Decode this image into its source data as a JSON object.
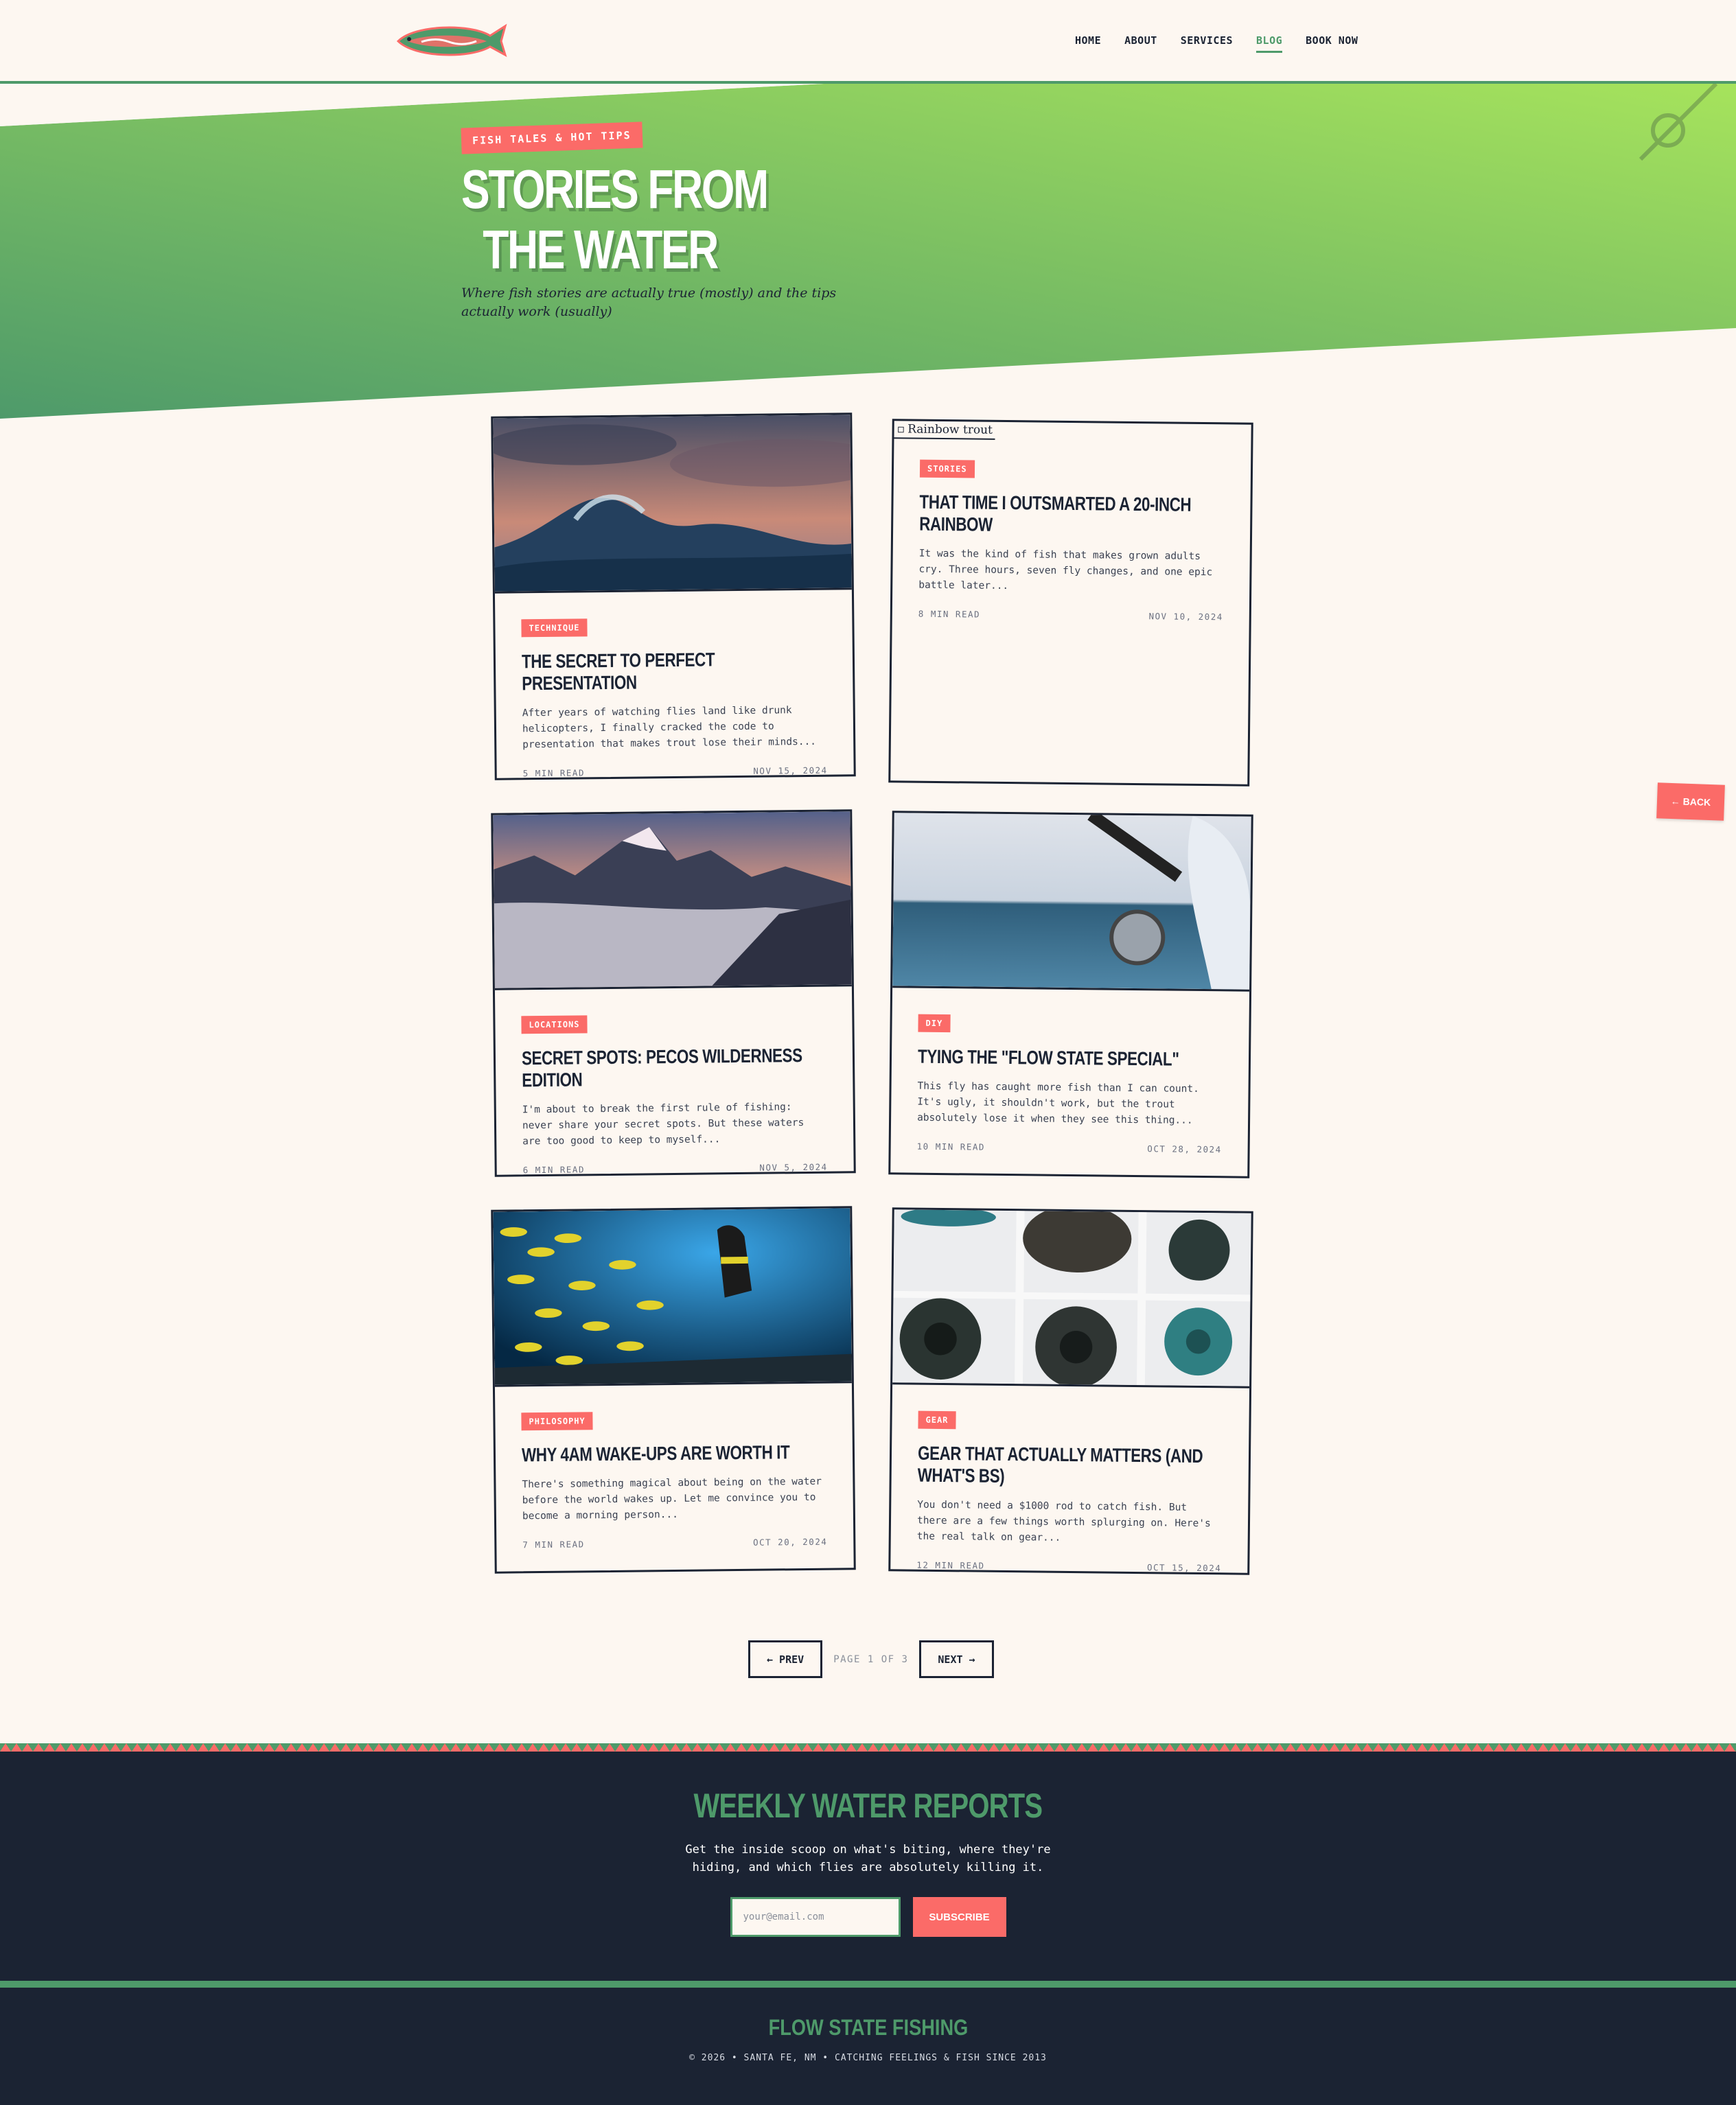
{
  "nav": {
    "links": [
      {
        "label": "HOME"
      },
      {
        "label": "ABOUT"
      },
      {
        "label": "SERVICES"
      },
      {
        "label": "BLOG",
        "active": true
      },
      {
        "label": "BOOK NOW"
      }
    ]
  },
  "hero": {
    "badge": "FISH TALES & HOT TIPS",
    "title_line1": "STORIES FROM",
    "title_line2": "THE WATER",
    "subtitle": "Where fish stories are actually true (mostly) and the tips actually work (usually)"
  },
  "posts": [
    {
      "tag": "TECHNIQUE",
      "title": "The Secret to Perfect Presentation",
      "excerpt": "After years of watching flies land like drunk helicopters, I finally cracked the code to presentation that makes trout lose their minds...",
      "read": "5 MIN READ",
      "date": "NOV 15, 2024",
      "image": "wave"
    },
    {
      "tag": "STORIES",
      "title": "That Time I Outsmarted a 20-Inch Rainbow",
      "excerpt": "It was the kind of fish that makes grown adults cry. Three hours, seven fly changes, and one epic battle later...",
      "read": "8 MIN READ",
      "date": "NOV 10, 2024",
      "image_alt": "Rainbow trout"
    },
    {
      "tag": "LOCATIONS",
      "title": "Secret Spots: Pecos Wilderness Edition",
      "excerpt": "I'm about to break the first rule of fishing: never share your secret spots. But these waters are too good to keep to myself...",
      "read": "6 MIN READ",
      "date": "NOV 5, 2024",
      "image": "mountains"
    },
    {
      "tag": "DIY",
      "title": "Tying the \"Flow State Special\"",
      "excerpt": "This fly has caught more fish than I can count. It's ugly, it shouldn't work, but the trout absolutely lose it when they see this thing...",
      "read": "10 MIN READ",
      "date": "OCT 28, 2024",
      "image": "reel"
    },
    {
      "tag": "PHILOSOPHY",
      "title": "Why 4AM Wake-Ups Are Worth It",
      "excerpt": "There's something magical about being on the water before the world wakes up. Let me convince you to become a morning person...",
      "read": "7 MIN READ",
      "date": "OCT 20, 2024",
      "image": "diver"
    },
    {
      "tag": "GEAR",
      "title": "Gear That Actually Matters (And What's BS)",
      "excerpt": "You don't need a $1000 rod to catch fish. But there are a few things worth splurging on. Here's the real talk on gear...",
      "read": "12 MIN READ",
      "date": "OCT 15, 2024",
      "image": "mats"
    }
  ],
  "back_button": "← BACK",
  "pagination": {
    "prev": "← PREV",
    "info": "PAGE 1 OF 3",
    "next": "NEXT →"
  },
  "newsletter": {
    "title": "WEEKLY WATER REPORTS",
    "description": "Get the inside scoop on what's biting, where they're hiding, and which flies are absolutely killing it.",
    "placeholder": "your@email.com",
    "button": "SUBSCRIBE"
  },
  "footer": {
    "title": "FLOW STATE FISHING",
    "copyright": "© 2026 • SANTA FE, NM • CATCHING FEELINGS & FISH SINCE 2013"
  },
  "colors": {
    "coral": "#fb6b68",
    "green": "#4e9a6a",
    "navy": "#1b2333",
    "cream": "#fdf7f1",
    "lime": "#a3e05a"
  }
}
